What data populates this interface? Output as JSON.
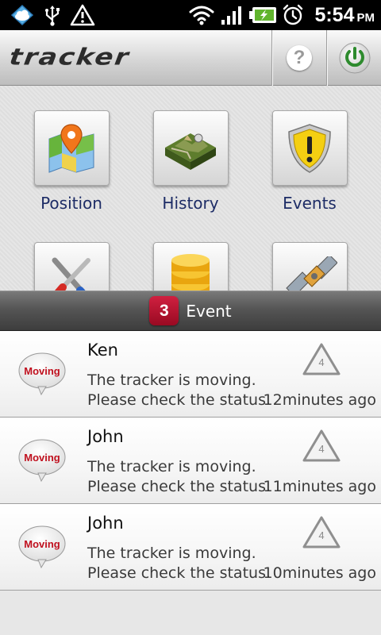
{
  "status_bar": {
    "time": "5:54",
    "ampm": "PM",
    "icons": [
      "weather-cloud-icon",
      "usb-icon",
      "warning-icon",
      "wifi-icon",
      "signal-icon",
      "battery-charging-icon",
      "alarm-icon"
    ]
  },
  "app": {
    "logo_text": "tracker",
    "help_label": "?",
    "accent_color": "#2e8b2e"
  },
  "menu": {
    "tiles": [
      {
        "label": "Position",
        "icon": "map-pin-icon"
      },
      {
        "label": "History",
        "icon": "terrain-history-icon"
      },
      {
        "label": "Events",
        "icon": "shield-warning-icon"
      },
      {
        "label": "",
        "icon": "tools-icon"
      },
      {
        "label": "",
        "icon": "database-icon"
      },
      {
        "label": "",
        "icon": "satellite-icon"
      }
    ]
  },
  "events_bar": {
    "count": "3",
    "label": "Event",
    "badge_color": "#b8102e"
  },
  "events": [
    {
      "name": "Ken",
      "message": "The tracker is moving.\nPlease check the status.",
      "time_ago": "12minutes ago",
      "bubble": "Moving",
      "level": "4"
    },
    {
      "name": "John",
      "message": "The tracker is moving.\nPlease check the status.",
      "time_ago": "11minutes ago",
      "bubble": "Moving",
      "level": "4"
    },
    {
      "name": "John",
      "message": "The tracker is moving.\nPlease check the status.",
      "time_ago": "10minutes ago",
      "bubble": "Moving",
      "level": "4"
    }
  ]
}
